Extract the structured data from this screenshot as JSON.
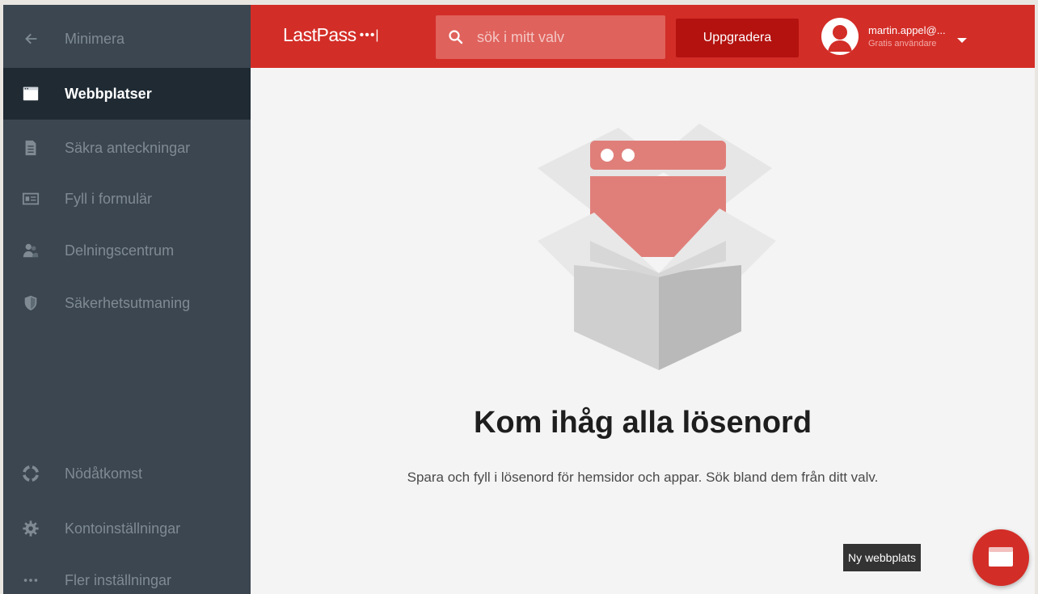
{
  "sidebar": {
    "collapse_label": "Minimera",
    "items": [
      {
        "label": "Webbplatser",
        "icon": "browser-window-icon"
      },
      {
        "label": "Säkra anteckningar",
        "icon": "note-icon"
      },
      {
        "label": "Fyll i formulär",
        "icon": "form-card-icon"
      },
      {
        "label": "Delningscentrum",
        "icon": "users-icon"
      },
      {
        "label": "Säkerhetsutmaning",
        "icon": "shield-icon"
      }
    ],
    "bottom_items": [
      {
        "label": "Nödåtkomst",
        "icon": "lifebuoy-icon"
      },
      {
        "label": "Kontoinställningar",
        "icon": "gear-icon"
      },
      {
        "label": "Fler inställningar",
        "icon": "more-dots-icon"
      }
    ]
  },
  "header": {
    "logo_text": "LastPass",
    "logo_dots": "•••|",
    "search_placeholder": "sök i mitt valv",
    "upgrade_label": "Uppgradera",
    "account_email": "martin.appel@...",
    "account_type": "Gratis användare"
  },
  "main": {
    "headline": "Kom ihåg alla lösenord",
    "subline": "Spara och fyll i lösenord för hemsidor och appar. Sök bland dem från ditt valv.",
    "add_tooltip": "Ny webbplats"
  },
  "colors": {
    "brand_red": "#d32d27",
    "sidebar_bg": "#3b4650",
    "sidebar_active": "#1f2a33"
  }
}
